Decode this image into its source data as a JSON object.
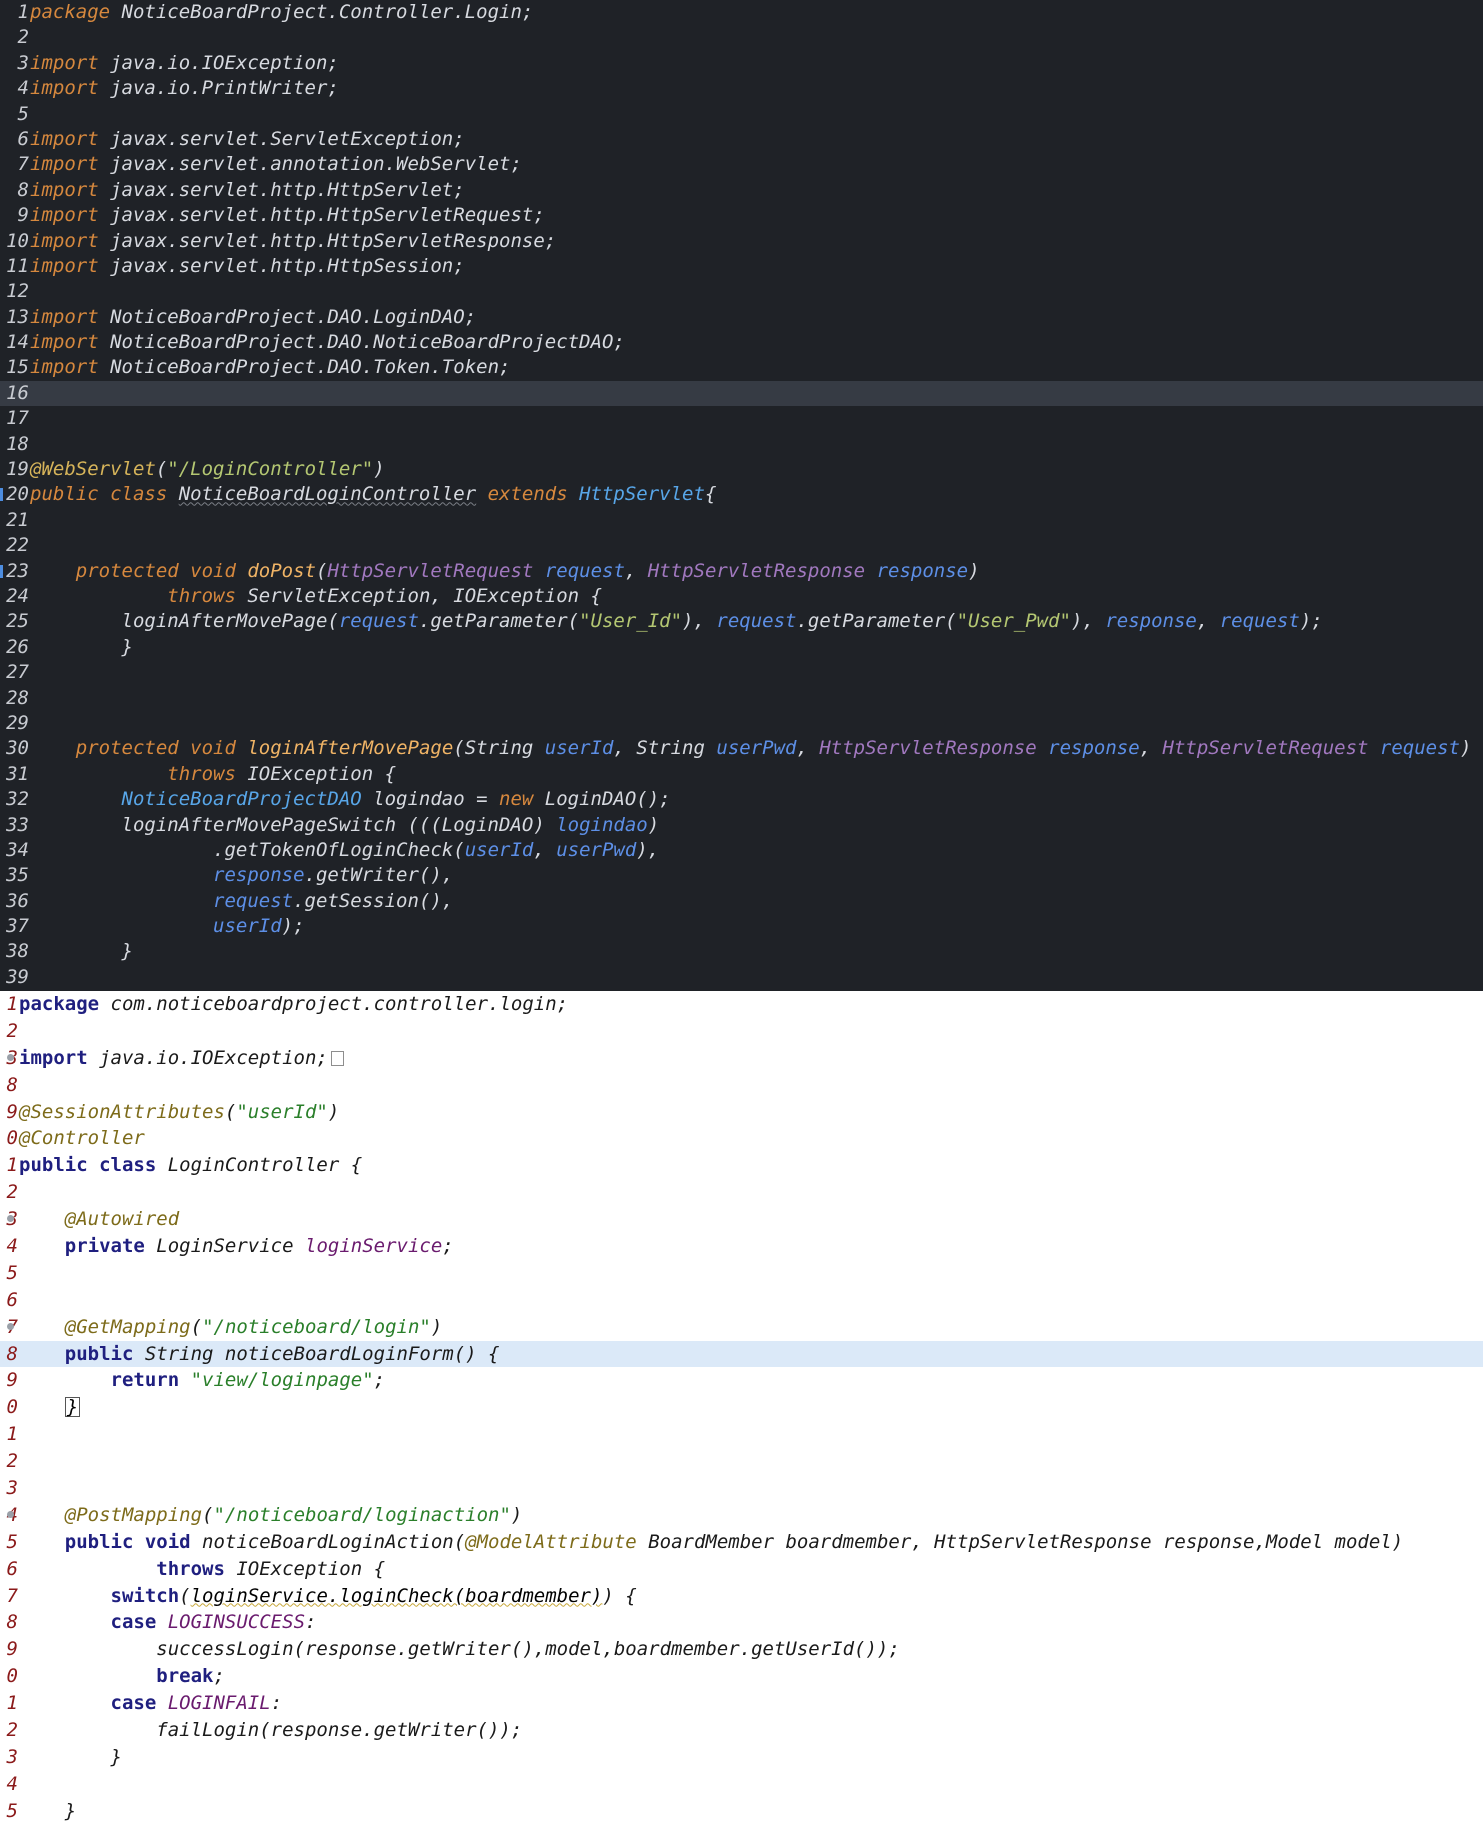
{
  "dark_editor": {
    "lines": [
      {
        "n": "1",
        "t": [
          [
            "kw",
            "package"
          ],
          [
            "plain",
            " NoticeBoardProject.Controller.Login;"
          ]
        ]
      },
      {
        "n": "2",
        "t": []
      },
      {
        "n": "3",
        "t": [
          [
            "kw",
            "import"
          ],
          [
            "plain",
            " java.io.IOException;"
          ]
        ]
      },
      {
        "n": "4",
        "t": [
          [
            "kw",
            "import"
          ],
          [
            "plain",
            " java.io.PrintWriter;"
          ]
        ]
      },
      {
        "n": "5",
        "t": []
      },
      {
        "n": "6",
        "t": [
          [
            "kw",
            "import"
          ],
          [
            "plain",
            " javax.servlet.ServletException;"
          ]
        ]
      },
      {
        "n": "7",
        "t": [
          [
            "kw",
            "import"
          ],
          [
            "plain",
            " javax.servlet.annotation.WebServlet;"
          ]
        ]
      },
      {
        "n": "8",
        "t": [
          [
            "kw",
            "import"
          ],
          [
            "plain",
            " javax.servlet.http.HttpServlet;"
          ]
        ]
      },
      {
        "n": "9",
        "t": [
          [
            "kw",
            "import"
          ],
          [
            "plain",
            " javax.servlet.http.HttpServletRequest;"
          ]
        ]
      },
      {
        "n": "10",
        "t": [
          [
            "kw",
            "import"
          ],
          [
            "plain",
            " javax.servlet.http.HttpServletResponse;"
          ]
        ]
      },
      {
        "n": "11",
        "t": [
          [
            "kw",
            "import"
          ],
          [
            "plain",
            " javax.servlet.http.HttpSession;"
          ]
        ]
      },
      {
        "n": "12",
        "t": []
      },
      {
        "n": "13",
        "t": [
          [
            "kw",
            "import"
          ],
          [
            "plain",
            " NoticeBoardProject.DAO.LoginDAO;"
          ]
        ]
      },
      {
        "n": "14",
        "t": [
          [
            "kw",
            "import"
          ],
          [
            "plain",
            " NoticeBoardProject.DAO.NoticeBoardProjectDAO;"
          ]
        ]
      },
      {
        "n": "15",
        "t": [
          [
            "kw",
            "import"
          ],
          [
            "plain",
            " NoticeBoardProject.DAO.Token.Token;"
          ]
        ]
      },
      {
        "n": "16",
        "t": [],
        "hl": true
      },
      {
        "n": "17",
        "t": []
      },
      {
        "n": "18",
        "t": []
      },
      {
        "n": "19",
        "t": [
          [
            "ann",
            "@WebServlet"
          ],
          [
            "plain",
            "("
          ],
          [
            "str",
            "\"/LoginController\""
          ],
          [
            "plain",
            ")"
          ]
        ]
      },
      {
        "n": "20",
        "mark": true,
        "t": [
          [
            "kw",
            "public class "
          ],
          [
            "under",
            "NoticeBoardLoginController"
          ],
          [
            "kw",
            " extends "
          ],
          [
            "type",
            "HttpServlet"
          ],
          [
            "plain",
            "{"
          ]
        ]
      },
      {
        "n": "21",
        "t": []
      },
      {
        "n": "22",
        "t": []
      },
      {
        "n": "23",
        "mark": true,
        "t": [
          [
            "plain",
            "    "
          ],
          [
            "kw",
            "protected void "
          ],
          [
            "fn",
            "doPost"
          ],
          [
            "plain",
            "("
          ],
          [
            "ptype",
            "HttpServletRequest"
          ],
          [
            "plain",
            " "
          ],
          [
            "param",
            "request"
          ],
          [
            "plain",
            ", "
          ],
          [
            "ptype",
            "HttpServletResponse"
          ],
          [
            "plain",
            " "
          ],
          [
            "param",
            "response"
          ],
          [
            "plain",
            ")"
          ]
        ]
      },
      {
        "n": "24",
        "t": [
          [
            "plain",
            "            "
          ],
          [
            "kw",
            "throws"
          ],
          [
            "plain",
            " ServletException, IOException {"
          ]
        ]
      },
      {
        "n": "25",
        "t": [
          [
            "plain",
            "        loginAfterMovePage("
          ],
          [
            "param",
            "request"
          ],
          [
            "plain",
            ".getParameter("
          ],
          [
            "str",
            "\"User_Id\""
          ],
          [
            "plain",
            "), "
          ],
          [
            "param",
            "request"
          ],
          [
            "plain",
            ".getParameter("
          ],
          [
            "str",
            "\"User_Pwd\""
          ],
          [
            "plain",
            "), "
          ],
          [
            "param",
            "response"
          ],
          [
            "plain",
            ", "
          ],
          [
            "param",
            "request"
          ],
          [
            "plain",
            ");"
          ]
        ]
      },
      {
        "n": "26",
        "t": [
          [
            "plain",
            "        }"
          ]
        ]
      },
      {
        "n": "27",
        "t": []
      },
      {
        "n": "28",
        "t": []
      },
      {
        "n": "29",
        "t": []
      },
      {
        "n": "30",
        "t": [
          [
            "plain",
            "    "
          ],
          [
            "kw",
            "protected void "
          ],
          [
            "fn",
            "loginAfterMovePage"
          ],
          [
            "plain",
            "(String "
          ],
          [
            "param",
            "userId"
          ],
          [
            "plain",
            ", String "
          ],
          [
            "param",
            "userPwd"
          ],
          [
            "plain",
            ", "
          ],
          [
            "ptype",
            "HttpServletResponse"
          ],
          [
            "plain",
            " "
          ],
          [
            "param",
            "response"
          ],
          [
            "plain",
            ", "
          ],
          [
            "ptype",
            "HttpServletRequest"
          ],
          [
            "plain",
            " "
          ],
          [
            "param",
            "request"
          ],
          [
            "plain",
            ")"
          ]
        ]
      },
      {
        "n": "31",
        "t": [
          [
            "plain",
            "            "
          ],
          [
            "kw",
            "throws"
          ],
          [
            "plain",
            " IOException {"
          ]
        ]
      },
      {
        "n": "32",
        "t": [
          [
            "plain",
            "        "
          ],
          [
            "type",
            "NoticeBoardProjectDAO"
          ],
          [
            "plain",
            " logindao = "
          ],
          [
            "kw",
            "new"
          ],
          [
            "plain",
            " LoginDAO();"
          ]
        ]
      },
      {
        "n": "33",
        "t": [
          [
            "plain",
            "        loginAfterMovePageSwitch (((LoginDAO) "
          ],
          [
            "param",
            "logindao"
          ],
          [
            "plain",
            ")"
          ]
        ]
      },
      {
        "n": "34",
        "t": [
          [
            "plain",
            "                .getTokenOfLoginCheck("
          ],
          [
            "param",
            "userId"
          ],
          [
            "plain",
            ", "
          ],
          [
            "param",
            "userPwd"
          ],
          [
            "plain",
            "),"
          ]
        ]
      },
      {
        "n": "35",
        "t": [
          [
            "plain",
            "                "
          ],
          [
            "param",
            "response"
          ],
          [
            "plain",
            ".getWriter(),"
          ]
        ]
      },
      {
        "n": "36",
        "t": [
          [
            "plain",
            "                "
          ],
          [
            "param",
            "request"
          ],
          [
            "plain",
            ".getSession(),"
          ]
        ]
      },
      {
        "n": "37",
        "t": [
          [
            "plain",
            "                "
          ],
          [
            "param",
            "userId"
          ],
          [
            "plain",
            ");"
          ]
        ]
      },
      {
        "n": "38",
        "t": [
          [
            "plain",
            "        }"
          ]
        ]
      },
      {
        "n": "39",
        "t": []
      }
    ]
  },
  "light_editor": {
    "lines": [
      {
        "n": "1",
        "t": [
          [
            "kwi",
            "package"
          ],
          [
            "plain",
            " com.noticeboardproject.controller.login;"
          ]
        ]
      },
      {
        "n": "2",
        "t": []
      },
      {
        "n": "3",
        "dot": true,
        "fold": true,
        "t": [
          [
            "kwi",
            "import"
          ],
          [
            "plain",
            " java.io.IOException;"
          ]
        ]
      },
      {
        "n": "8",
        "t": []
      },
      {
        "n": "9",
        "t": [
          [
            "annw",
            "@SessionAttributes"
          ],
          [
            "plain",
            "("
          ],
          [
            "str",
            "\"userId\""
          ],
          [
            "plain",
            ")"
          ]
        ]
      },
      {
        "n": "0",
        "t": [
          [
            "annw",
            "@Controller"
          ]
        ]
      },
      {
        "n": "1",
        "t": [
          [
            "kwi",
            "public class"
          ],
          [
            "plain",
            " LoginController {"
          ]
        ]
      },
      {
        "n": "2",
        "t": []
      },
      {
        "n": "3",
        "dot": true,
        "t": [
          [
            "plain",
            "    "
          ],
          [
            "annw",
            "@Autowired"
          ]
        ]
      },
      {
        "n": "4",
        "t": [
          [
            "plain",
            "    "
          ],
          [
            "kwi",
            "private"
          ],
          [
            "plain",
            " LoginService "
          ],
          [
            "purple",
            "loginService"
          ],
          [
            "plain",
            ";"
          ]
        ]
      },
      {
        "n": "5",
        "t": []
      },
      {
        "n": "6",
        "t": []
      },
      {
        "n": "7",
        "dot": true,
        "t": [
          [
            "plain",
            "    "
          ],
          [
            "annw",
            "@GetMapping"
          ],
          [
            "plain",
            "("
          ],
          [
            "str",
            "\"/noticeboard/login\""
          ],
          [
            "plain",
            ")"
          ]
        ]
      },
      {
        "n": "8",
        "hl": true,
        "t": [
          [
            "plain",
            "    "
          ],
          [
            "kwi",
            "public"
          ],
          [
            "plain",
            " String noticeBoardLoginForm() {"
          ]
        ]
      },
      {
        "n": "9",
        "t": [
          [
            "plain",
            "        "
          ],
          [
            "kwi",
            "return"
          ],
          [
            "plain",
            " "
          ],
          [
            "str",
            "\"view/loginpage\""
          ],
          [
            "plain",
            ";"
          ]
        ]
      },
      {
        "n": "0",
        "t": [
          [
            "plain",
            "    "
          ],
          [
            "brace",
            "}"
          ]
        ]
      },
      {
        "n": "1",
        "t": []
      },
      {
        "n": "2",
        "t": []
      },
      {
        "n": "3",
        "t": []
      },
      {
        "n": "4",
        "dot": true,
        "t": [
          [
            "plain",
            "    "
          ],
          [
            "annw",
            "@PostMapping"
          ],
          [
            "plain",
            "("
          ],
          [
            "str",
            "\"/noticeboard/loginaction\""
          ],
          [
            "plain",
            ")"
          ]
        ]
      },
      {
        "n": "5",
        "t": [
          [
            "plain",
            "    "
          ],
          [
            "kwi",
            "public void"
          ],
          [
            "plain",
            " noticeBoardLoginAction("
          ],
          [
            "annw",
            "@ModelAttribute"
          ],
          [
            "plain",
            " BoardMember boardmember, HttpServletResponse response,Model model)"
          ]
        ]
      },
      {
        "n": "6",
        "t": [
          [
            "plain",
            "            "
          ],
          [
            "kwi",
            "throws"
          ],
          [
            "plain",
            " IOException {"
          ]
        ]
      },
      {
        "n": "7",
        "t": [
          [
            "plain",
            "        "
          ],
          [
            "kwi",
            "switch"
          ],
          [
            "plain",
            "("
          ],
          [
            "under",
            "loginService.loginCheck(boardmember)"
          ],
          [
            "plain",
            ") {"
          ]
        ]
      },
      {
        "n": "8",
        "t": [
          [
            "plain",
            "        "
          ],
          [
            "kwi",
            "case"
          ],
          [
            "plain",
            " "
          ],
          [
            "enum",
            "LOGINSUCCESS"
          ],
          [
            "plain",
            ":"
          ]
        ]
      },
      {
        "n": "9",
        "t": [
          [
            "plain",
            "            successLogin(response.getWriter(),model,boardmember.getUserId());"
          ]
        ]
      },
      {
        "n": "0",
        "t": [
          [
            "plain",
            "            "
          ],
          [
            "kwi",
            "break"
          ],
          [
            "plain",
            ";"
          ]
        ]
      },
      {
        "n": "1",
        "t": [
          [
            "plain",
            "        "
          ],
          [
            "kwi",
            "case"
          ],
          [
            "plain",
            " "
          ],
          [
            "enum",
            "LOGINFAIL"
          ],
          [
            "plain",
            ":"
          ]
        ]
      },
      {
        "n": "2",
        "t": [
          [
            "plain",
            "            failLogin(response.getWriter());"
          ]
        ]
      },
      {
        "n": "3",
        "t": [
          [
            "plain",
            "        }"
          ]
        ]
      },
      {
        "n": "4",
        "t": []
      },
      {
        "n": "5",
        "t": [
          [
            "plain",
            "    }"
          ]
        ]
      }
    ]
  }
}
